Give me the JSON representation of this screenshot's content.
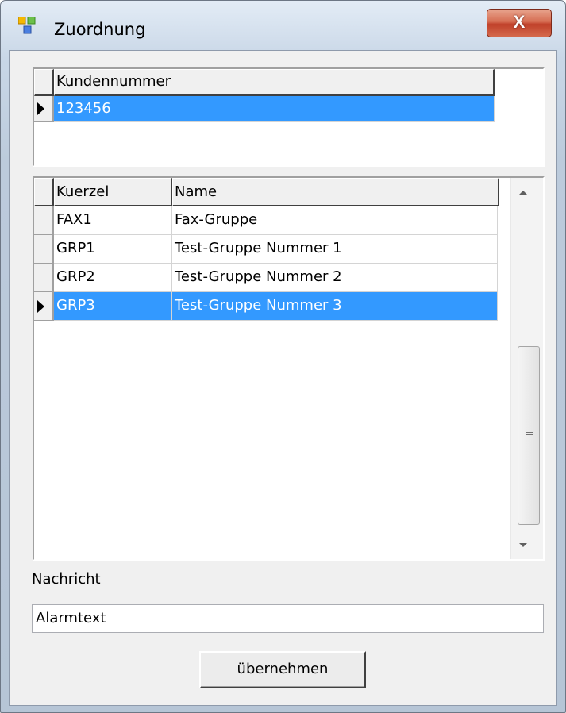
{
  "window": {
    "title": "Zuordnung",
    "close_symbol": "X"
  },
  "customer_grid": {
    "columns": [
      "Kundennummer"
    ],
    "rows": [
      {
        "kundennummer": "123456",
        "selected": true
      }
    ]
  },
  "group_grid": {
    "columns": [
      "Kuerzel",
      "Name"
    ],
    "rows": [
      {
        "kuerzel": "FAX1",
        "name": "Fax-Gruppe",
        "selected": false
      },
      {
        "kuerzel": "GRP1",
        "name": "Test-Gruppe Nummer 1",
        "selected": false
      },
      {
        "kuerzel": "GRP2",
        "name": "Test-Gruppe Nummer 2",
        "selected": false
      },
      {
        "kuerzel": "GRP3",
        "name": "Test-Gruppe Nummer 3",
        "selected": true
      }
    ]
  },
  "message": {
    "label": "Nachricht",
    "value": "Alarmtext"
  },
  "apply_button": {
    "label": "übernehmen"
  },
  "colors": {
    "selection": "#3399ff",
    "close_button": "#c0412a"
  }
}
